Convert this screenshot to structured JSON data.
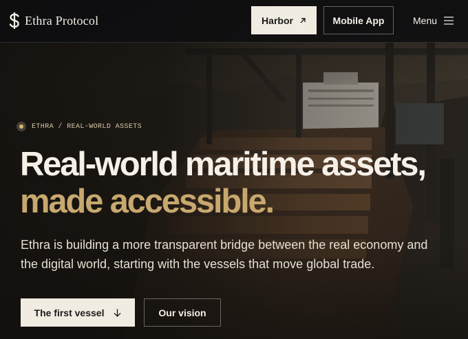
{
  "header": {
    "brand_name": "Ethra Protocol",
    "brand_icon": "dollar-sign-logo",
    "harbor_label": "Harbor",
    "harbor_icon": "arrow-north-east-icon",
    "mobile_app_label": "Mobile App",
    "menu_label": "Menu",
    "menu_icon": "hamburger-icon"
  },
  "hero": {
    "breadcrumb": "ETHRA / REAL-WORLD ASSETS",
    "headline_line1": "Real-world maritime assets,",
    "headline_line2": "made accessible.",
    "subtext": "Ethra is building a more transparent bridge between the real economy and the digital world, starting with the vessels that move global trade.",
    "primary_cta": "The first vessel",
    "primary_cta_icon": "arrow-down-icon",
    "secondary_cta": "Our vision",
    "background_image": "cargo ship at port with cranes"
  },
  "colors": {
    "accent_gold": "#c7a86e",
    "light_button": "#f1ece2",
    "header_bg": "#0e0e10",
    "text_light": "#f6f1e8"
  }
}
